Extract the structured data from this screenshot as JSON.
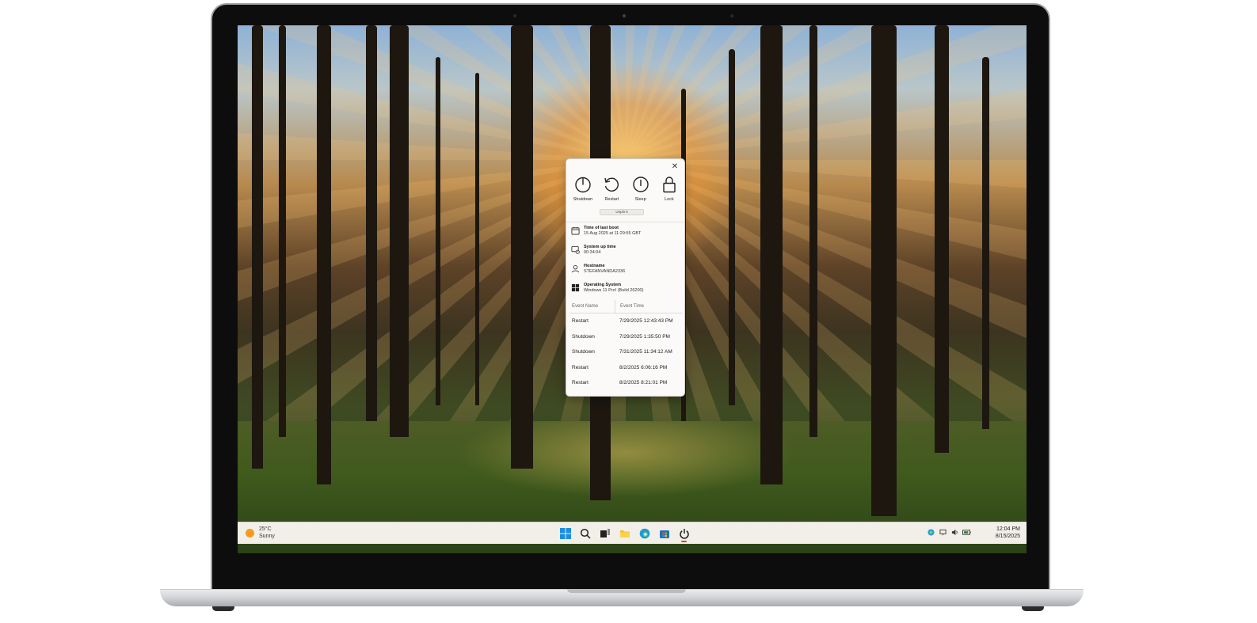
{
  "flyout": {
    "close_symbol": "✕",
    "power_buttons": [
      {
        "label": "Shutdown",
        "icon": "power-icon"
      },
      {
        "label": "Restart",
        "icon": "restart-icon"
      },
      {
        "label": "Sleep",
        "icon": "sleep-icon"
      },
      {
        "label": "Lock",
        "icon": "lock-icon"
      }
    ],
    "unpin_label": "Unpin it",
    "info": [
      {
        "title": "Time of last boot",
        "value": "15 Aug 2025 at 11:29:55 GBT",
        "icon": "calendar-icon"
      },
      {
        "title": "System up time",
        "value": "00:34:04",
        "icon": "uptime-icon"
      },
      {
        "title": "Hostname",
        "value": "STEFANVANDA2336",
        "icon": "user-icon"
      },
      {
        "title": "Operating System",
        "value": "Windows 11 Pro! (Build 26200)",
        "icon": "windows-logo-icon"
      }
    ],
    "events": {
      "headers": [
        "Event Name",
        "Event Time"
      ],
      "rows": [
        [
          "Restart",
          "7/29/2025 12:43:43 PM"
        ],
        [
          "Shutdown",
          "7/29/2025 1:35:50 PM"
        ],
        [
          "Shutdown",
          "7/31/2025 11:34:12 AM"
        ],
        [
          "Restart",
          "8/2/2025 6:06:16 PM"
        ],
        [
          "Restart",
          "8/2/2025 8:21:01 PM"
        ]
      ]
    }
  },
  "taskbar": {
    "weather": {
      "temp": "25°C",
      "condition": "Sunny"
    },
    "apps": [
      "start-icon",
      "search-icon",
      "task-view-icon",
      "file-explorer-icon",
      "edge-icon",
      "store-icon",
      "power-app-icon"
    ],
    "tray": [
      "defender-icon",
      "network-icon",
      "volume-icon",
      "battery-icon"
    ],
    "time": "12:04 PM",
    "date": "8/15/2025"
  },
  "colors": {
    "accent": "#d9412a",
    "taskbar_bg": "#f2efe8",
    "flyout_bg": "#fbfaf8"
  }
}
